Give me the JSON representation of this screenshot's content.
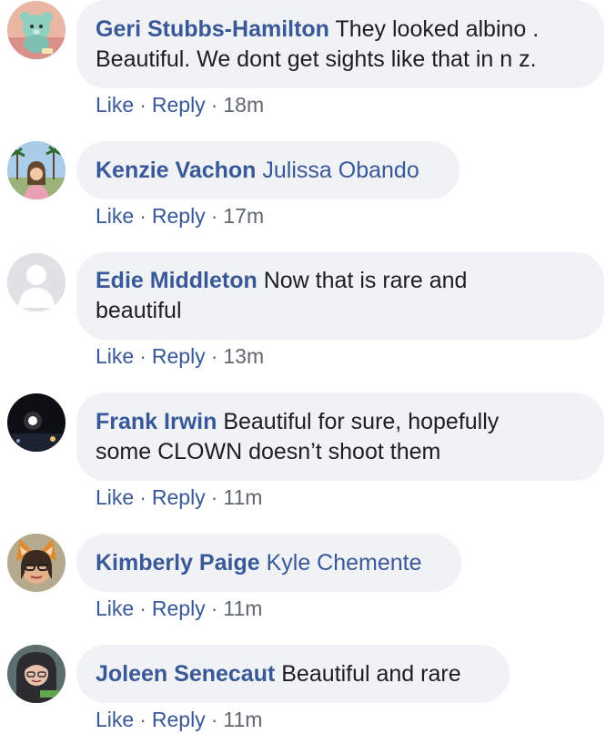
{
  "colors": {
    "author": "#385898",
    "link": "#385898",
    "bubble": "#f0f2f5",
    "text": "#1c1e21",
    "meta": "#606770"
  },
  "actions": {
    "like_label": "Like",
    "reply_label": "Reply",
    "separator": "·"
  },
  "comments": [
    {
      "author": "Geri Stubbs-Hamilton",
      "text": " They looked albino . Beautiful. We dont get sights like that in n z.",
      "time": "18m",
      "avatar_icon": "teddy-bear-avatar"
    },
    {
      "author": "Kenzie Vachon",
      "text": " Julissa Obando",
      "time": "17m",
      "avatar_icon": "palm-trees-avatar"
    },
    {
      "author": "Edie Middleton",
      "text": " Now that is rare and beautiful",
      "time": "13m",
      "avatar_icon": "default-silhouette-avatar"
    },
    {
      "author": "Frank Irwin",
      "text": " Beautiful for sure, hopefully some CLOWN doesn’t shoot them",
      "time": "11m",
      "avatar_icon": "night-scene-avatar"
    },
    {
      "author": "Kimberly Paige",
      "text": " Kyle Chemente",
      "time": "11m",
      "avatar_icon": "cat-ears-filter-avatar"
    },
    {
      "author": "Joleen Senecaut",
      "text": " Beautiful and rare",
      "time": "11m",
      "avatar_icon": "portrait-avatar"
    }
  ]
}
